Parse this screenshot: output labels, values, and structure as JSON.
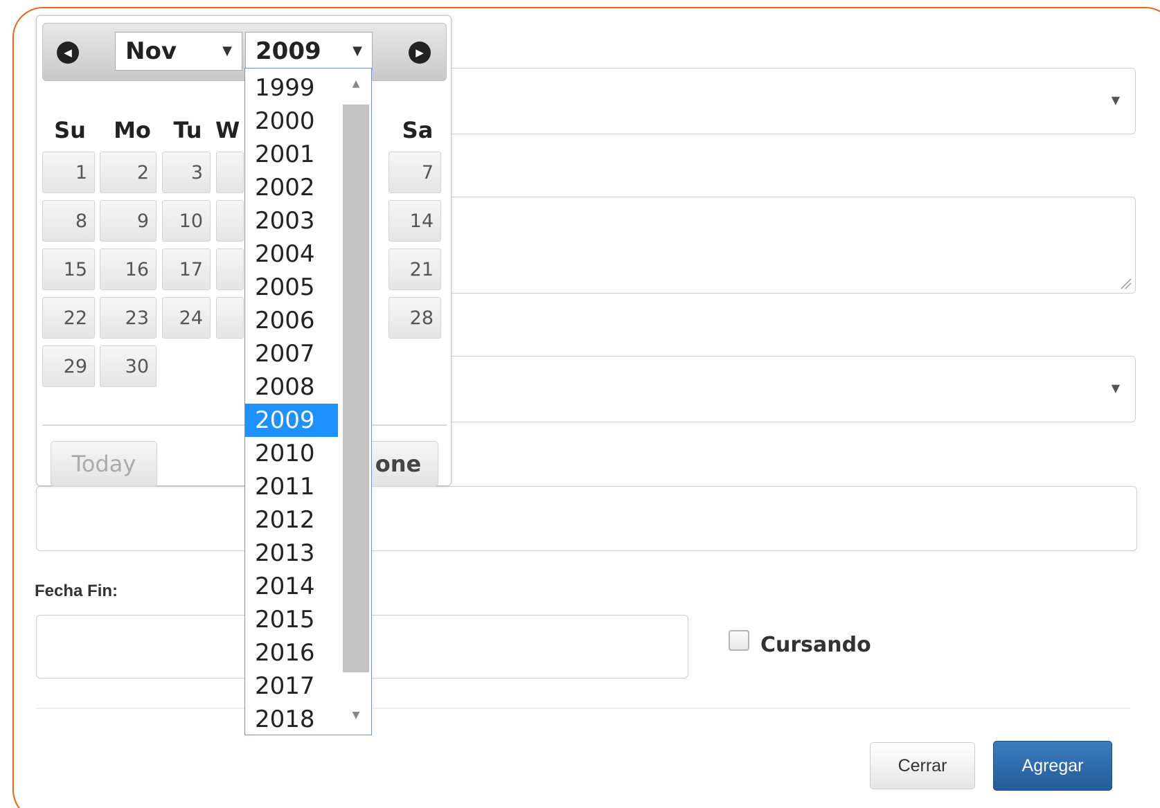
{
  "form": {
    "fecha_fin_label": "Fecha Fin:",
    "cursando_label": "Cursando",
    "close_button": "Cerrar",
    "add_button": "Agregar",
    "dropdown_caret": "▼"
  },
  "datepicker": {
    "prev_icon": "◀",
    "next_icon": "▶",
    "month": "Nov",
    "year": "2009",
    "arrow": "▼",
    "weekdays": [
      "Su",
      "Mo",
      "Tu",
      "W",
      "Sa"
    ],
    "visible_days": [
      "1",
      "2",
      "3",
      "7",
      "8",
      "9",
      "10",
      "14",
      "15",
      "16",
      "17",
      "21",
      "22",
      "23",
      "24",
      "28",
      "29",
      "30"
    ],
    "today_button": "Today",
    "done_button": "one",
    "year_options": [
      "1999",
      "2000",
      "2001",
      "2002",
      "2003",
      "2004",
      "2005",
      "2006",
      "2007",
      "2008",
      "2009",
      "2010",
      "2011",
      "2012",
      "2013",
      "2014",
      "2015",
      "2016",
      "2017",
      "2018"
    ],
    "selected_year": "2009"
  },
  "colors": {
    "modal_border": "#e8651a",
    "selected_year_bg": "#1e90ff",
    "primary_button": "#2e6da4"
  }
}
